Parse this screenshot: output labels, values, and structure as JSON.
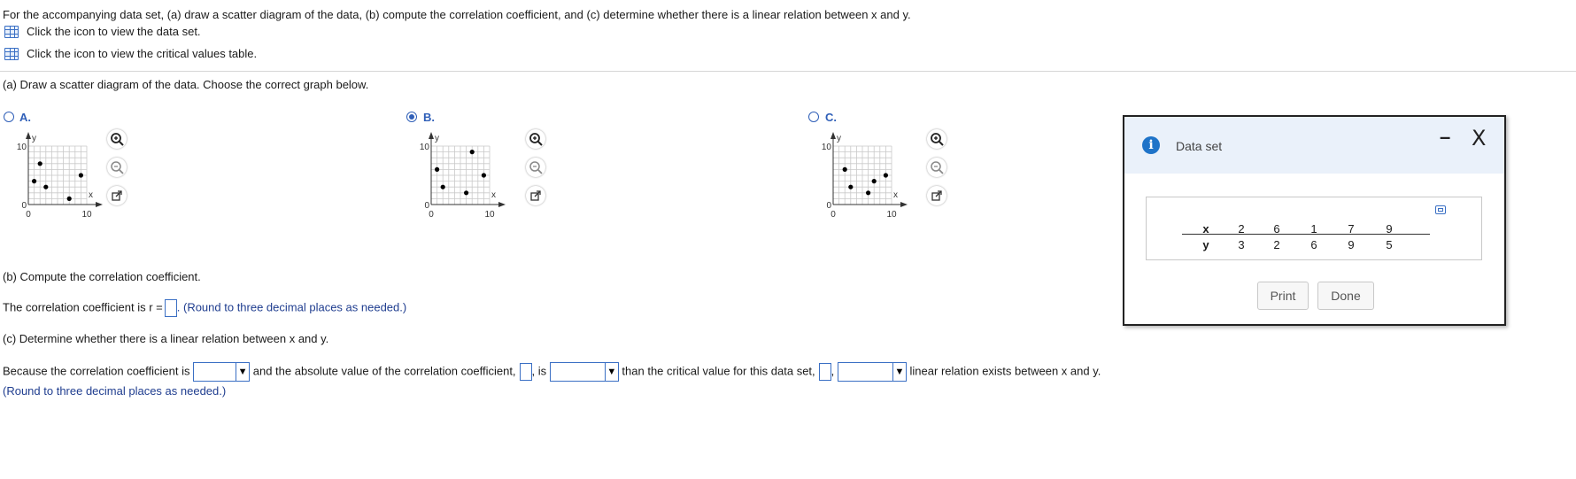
{
  "intro": {
    "question": "For the accompanying data set, (a) draw a scatter diagram of the data, (b) compute the correlation coefficient, and (c) determine whether there is a linear relation between x and y.",
    "link1": "Click the icon to view the data set.",
    "link2": "Click the icon to view the critical values table."
  },
  "part_a": {
    "prompt": "(a) Draw a scatter diagram of the data. Choose the correct graph below.",
    "options": [
      {
        "label": "A.",
        "selected": false
      },
      {
        "label": "B.",
        "selected": true
      },
      {
        "label": "C.",
        "selected": false
      }
    ],
    "axis": {
      "y_label": "y",
      "x_label": "x",
      "y_max": "10",
      "y_min": "0",
      "x_min": "0",
      "x_max": "10"
    }
  },
  "chart_data": [
    {
      "type": "scatter",
      "xlim": [
        0,
        10
      ],
      "ylim": [
        0,
        10
      ],
      "xlabel": "x",
      "ylabel": "y",
      "points": [
        [
          2,
          7
        ],
        [
          3,
          3
        ],
        [
          1,
          4
        ],
        [
          7,
          1
        ],
        [
          9,
          5
        ]
      ]
    },
    {
      "type": "scatter",
      "xlim": [
        0,
        10
      ],
      "ylim": [
        0,
        10
      ],
      "xlabel": "x",
      "ylabel": "y",
      "points": [
        [
          2,
          3
        ],
        [
          6,
          2
        ],
        [
          1,
          6
        ],
        [
          7,
          9
        ],
        [
          9,
          5
        ]
      ]
    },
    {
      "type": "scatter",
      "xlim": [
        0,
        10
      ],
      "ylim": [
        0,
        10
      ],
      "xlabel": "x",
      "ylabel": "y",
      "points": [
        [
          3,
          3
        ],
        [
          2,
          6
        ],
        [
          6,
          2
        ],
        [
          7,
          4
        ],
        [
          9,
          5
        ]
      ]
    }
  ],
  "part_b": {
    "prompt": "(b) Compute the correlation coefficient.",
    "sentence_start": "The correlation coefficient is r =",
    "sentence_end": ". (Round to three decimal places as needed.)"
  },
  "part_c": {
    "prompt": "(c) Determine whether there is a linear relation between x and y.",
    "seg1": "Because the correlation coefficient is",
    "seg2": "and the absolute value of the correlation coefficient,",
    "seg3": ", is",
    "seg4": "than the critical value for this data set,",
    "seg5": ",",
    "seg6": "linear relation exists between x and y.",
    "note": "(Round to three decimal places as needed.)"
  },
  "dialog": {
    "title": "Data set",
    "x_header": "x",
    "y_header": "y",
    "x_values": [
      "2",
      "6",
      "1",
      "7",
      "9"
    ],
    "y_values": [
      "3",
      "2",
      "6",
      "9",
      "5"
    ],
    "print_label": "Print",
    "done_label": "Done",
    "minimize_glyph": "–",
    "close_glyph": "X"
  },
  "colors": {
    "accent": "#2f5fb8",
    "link_text": "#1f3d8f"
  }
}
